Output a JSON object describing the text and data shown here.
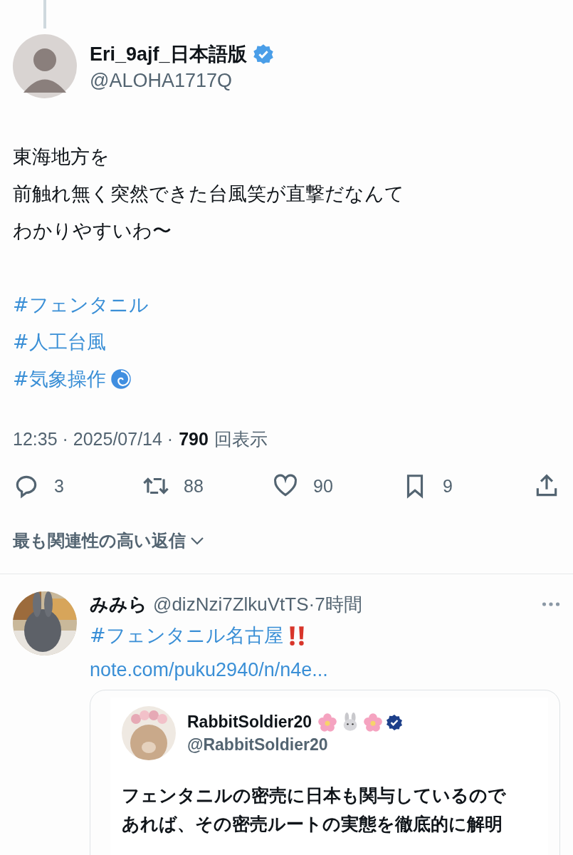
{
  "post": {
    "author": {
      "name": "Eri_9ajf_日本語版",
      "verified": true,
      "handle": "@ALOHA1717Q"
    },
    "lines": [
      "東海地方を",
      "前触れ無く突然できた台風笑が直撃だなんて",
      "わかりやすいわ〜"
    ],
    "hashtags": [
      {
        "text": "#フェンタニル",
        "emoji": false
      },
      {
        "text": "#人工台風",
        "emoji": false
      },
      {
        "text": "#気象操作",
        "emoji": true
      }
    ],
    "meta": "12:35 · 2025/07/14 ·",
    "views": "790",
    "views_label": "回表示",
    "actions": [
      {
        "kind": "reply",
        "count": "3"
      },
      {
        "kind": "repost",
        "count": "88"
      },
      {
        "kind": "like",
        "count": "90"
      },
      {
        "kind": "bookmark",
        "count": "9"
      },
      {
        "kind": "share"
      }
    ]
  },
  "sort": {
    "label": "最も関連性の高い返信"
  },
  "reply": {
    "name": "みみら",
    "handle_line": "@dizNzi7ZlkuVtTS·7時間",
    "hashtag": "#フェンタニル名古屋",
    "link": "note.com/puku2940/n/n4e...",
    "quote": {
      "name": "RabbitSoldier20",
      "verified": true,
      "handle": "@RabbitSoldier20",
      "lines": [
        "フェンタニルの密売に日本も関与しているので",
        "あれば、その密売ルートの実態を徹底的に解明"
      ]
    }
  }
}
